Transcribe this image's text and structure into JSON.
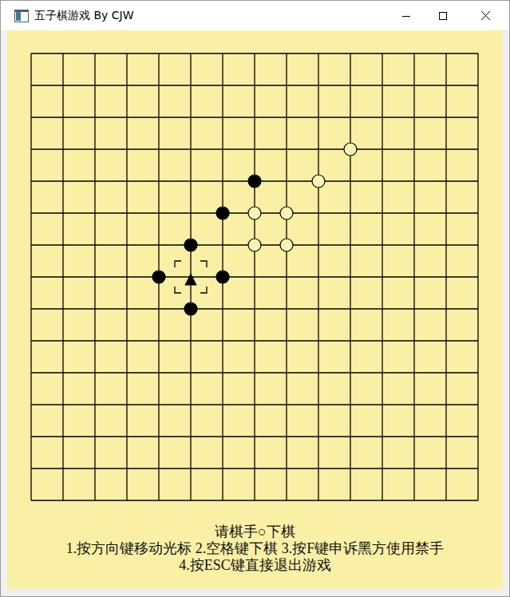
{
  "window": {
    "title": "五子棋游戏 By CJW"
  },
  "board": {
    "size": 15,
    "cursor": {
      "row": 7,
      "col": 5
    },
    "last_move_mark": "▲",
    "stones": [
      {
        "row": 4,
        "col": 7,
        "kind": "black",
        "last": false
      },
      {
        "row": 5,
        "col": 6,
        "kind": "black",
        "last": false
      },
      {
        "row": 6,
        "col": 5,
        "kind": "black",
        "last": false
      },
      {
        "row": 7,
        "col": 4,
        "kind": "black",
        "last": false
      },
      {
        "row": 7,
        "col": 5,
        "kind": "black",
        "last": true
      },
      {
        "row": 7,
        "col": 6,
        "kind": "black",
        "last": false
      },
      {
        "row": 8,
        "col": 5,
        "kind": "black",
        "last": false
      },
      {
        "row": 3,
        "col": 10,
        "kind": "white",
        "last": false
      },
      {
        "row": 4,
        "col": 9,
        "kind": "white",
        "last": false
      },
      {
        "row": 5,
        "col": 7,
        "kind": "white",
        "last": false
      },
      {
        "row": 5,
        "col": 8,
        "kind": "white",
        "last": false
      },
      {
        "row": 6,
        "col": 7,
        "kind": "white",
        "last": false
      },
      {
        "row": 6,
        "col": 8,
        "kind": "white",
        "last": false
      }
    ]
  },
  "status": "请棋手○下棋",
  "instructions": [
    "1.按方向键移动光标 2.空格键下棋 3.按F键申诉黑方使用禁手",
    "4.按ESC键直接退出游戏"
  ]
}
